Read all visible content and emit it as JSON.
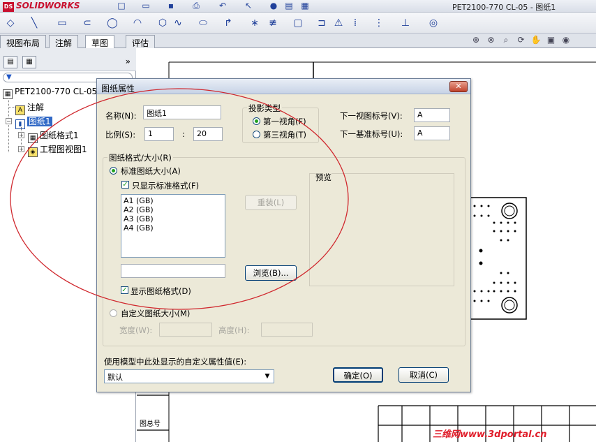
{
  "app": {
    "logo": "SOLIDWORKS",
    "document_title": "PET2100-770 CL-05 - 图纸1"
  },
  "tabs": [
    "视图布局",
    "注解",
    "草图",
    "评估"
  ],
  "tree": {
    "root": "PET2100-770 CL-05",
    "items": [
      "注解",
      "图纸1",
      "图纸格式1",
      "工程图视图1"
    ]
  },
  "dialog": {
    "title": "图纸属性",
    "close": "✕",
    "name_label": "名称(N):",
    "name_value": "图纸1",
    "scale_label": "比例(S):",
    "scale_a": "1",
    "scale_sep": ":",
    "scale_b": "20",
    "projection_title": "投影类型",
    "first_angle": "第一视角(F)",
    "third_angle": "第三视角(T)",
    "next_view_label": "下一视图标号(V):",
    "next_view_value": "A",
    "next_datum_label": "下一基准标号(U):",
    "next_datum_value": "A",
    "format_group_title": "图纸格式/大小(R)",
    "standard_size": "标准图纸大小(A)",
    "only_standard": "只显示标准格式(F)",
    "sizes": [
      "A1 (GB)",
      "A2 (GB)",
      "A3 (GB)",
      "A4 (GB)"
    ],
    "reload": "重装(L)",
    "browse": "浏览(B)...",
    "show_format": "显示图纸格式(D)",
    "custom_size": "自定义图纸大小(M)",
    "width_label": "宽度(W):",
    "height_label": "高度(H):",
    "preview_label": "预览",
    "model_prop_label": "使用模型中此处显示的自定义属性值(E):",
    "model_prop_value": "默认",
    "ok": "确定(O)",
    "cancel": "取消(C)"
  },
  "drawing": {
    "title_block_label": "图总号"
  },
  "watermark": "三维网www.3dportal.cn",
  "colors": {
    "annotation_ellipse": "#d0282e",
    "selection": "#3169c6",
    "radio_dot": "#21a121"
  }
}
